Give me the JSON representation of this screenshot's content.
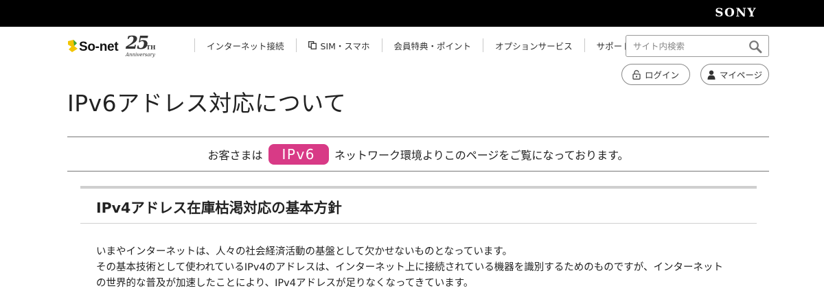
{
  "header": {
    "brand": "SONY"
  },
  "logo": {
    "name": "So-net",
    "anniversary_number": "25",
    "anniversary_suffix": "TH",
    "anniversary_label": "Anniversary"
  },
  "nav": {
    "items": [
      {
        "label": "インターネット接続",
        "icon": ""
      },
      {
        "label": "SIM・スマホ",
        "icon": "phone-copy-icon"
      },
      {
        "label": "会員特典・ポイント",
        "icon": ""
      },
      {
        "label": "オプションサービス",
        "icon": ""
      },
      {
        "label": "サポート",
        "icon": ""
      }
    ]
  },
  "search": {
    "placeholder": "サイト内検索",
    "value": "",
    "icon": "search-icon"
  },
  "account": {
    "login_label": "ログイン",
    "login_icon": "lock-open-icon",
    "mypage_label": "マイページ",
    "mypage_icon": "person-icon"
  },
  "page": {
    "title": "IPv6アドレス対応について"
  },
  "notice": {
    "prefix": "お客さまは",
    "badge": "IPv6",
    "suffix": "ネットワーク環境よりこのページをご覧になっております。",
    "badge_color": "#d83a86"
  },
  "section": {
    "heading": "IPv4アドレス在庫枯渇対応の基本方針",
    "paragraph_lines": [
      "いまやインターネットは、人々の社会経済活動の基盤として欠かせないものとなっています。",
      "その基本技術として使われているIPv4のアドレスは、インターネット上に接続されている機器を識別するためのものですが、インターネット",
      "の世界的な普及が加速したことにより、IPv4アドレスが足りなくなってきています。"
    ]
  },
  "colors": {
    "top_bar": "#000000",
    "accent": "#d83a86"
  }
}
